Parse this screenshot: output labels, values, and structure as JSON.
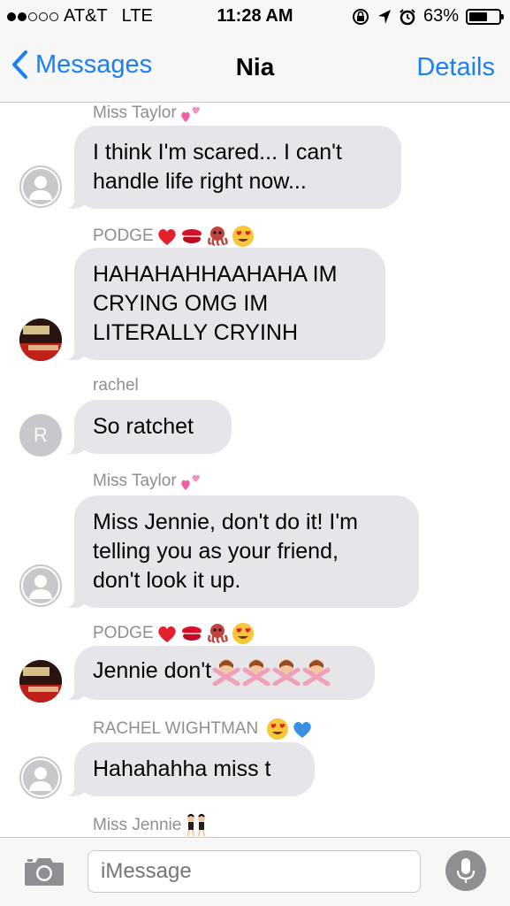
{
  "status": {
    "carrier": "AT&T",
    "network": "LTE",
    "time": "11:28 AM",
    "battery": "63%",
    "battery_level": 0.63
  },
  "nav": {
    "back_label": "Messages",
    "title": "Nia",
    "details_label": "Details"
  },
  "messages": [
    {
      "sender": "Miss Taylor",
      "text_lines": [
        "I think I'm scared... I can't",
        "handle life right now..."
      ]
    },
    {
      "sender": "PODGE",
      "text_lines": [
        "HAHAHAHHAAHAHA IM",
        "CRYING OMG IM",
        "LITERALLY CRYINH"
      ]
    },
    {
      "sender": "rachel",
      "avatar_letter": "R",
      "text_lines": [
        "So ratchet"
      ]
    },
    {
      "sender": "Miss Taylor",
      "text_lines": [
        "Miss Jennie, don't do it! I'm",
        "telling you as your friend,",
        "don't look it up."
      ]
    },
    {
      "sender": "PODGE",
      "text_lines": [
        "Jennie don't"
      ]
    },
    {
      "sender": "RACHEL WIGHTMAN",
      "text_lines": [
        "Hahahahha miss t"
      ]
    },
    {
      "sender": "Miss Jennie"
    }
  ],
  "input": {
    "placeholder": "iMessage"
  },
  "icons": [
    "signal-dots-icon",
    "rotation-lock-icon",
    "location-arrow-icon",
    "alarm-icon",
    "battery-icon",
    "back-chevron-icon",
    "camera-icon",
    "microphone-icon",
    "default-avatar-icon"
  ],
  "colors": {
    "accent": "#1a7ff0",
    "bubble": "#e5e5ea",
    "sender_text": "#8e8e93"
  }
}
